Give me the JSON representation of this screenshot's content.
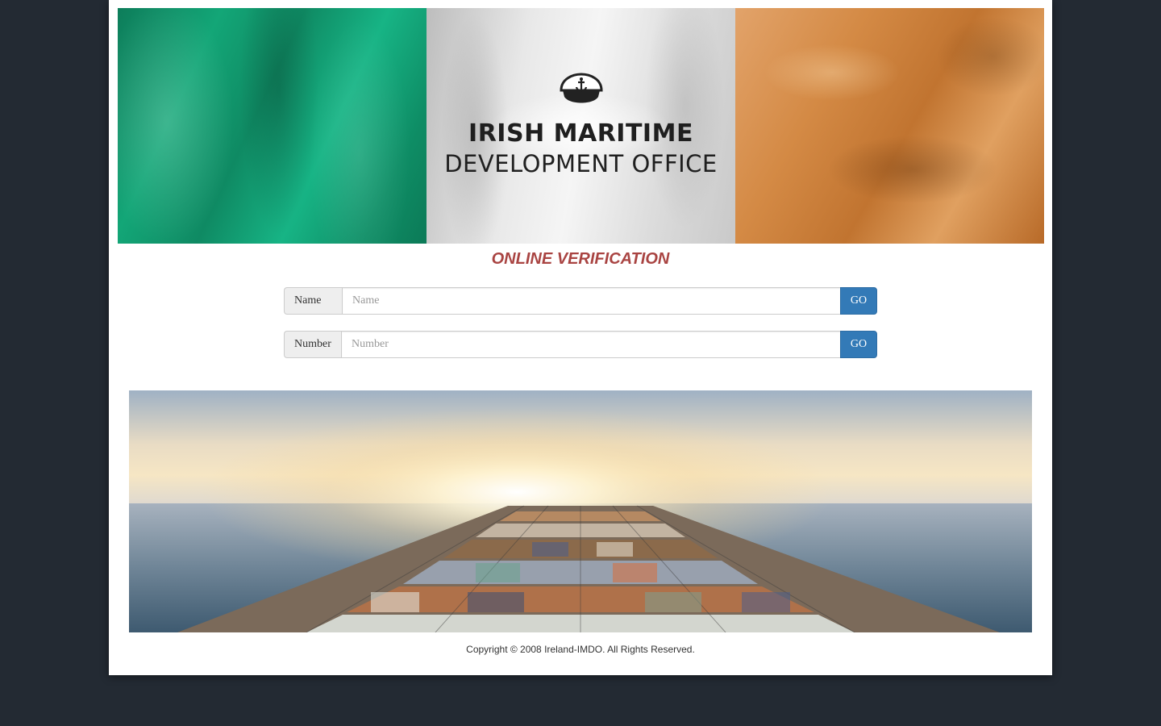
{
  "header": {
    "org_title": "IRISH MARITIME",
    "org_subtitle": "DEVELOPMENT OFFICE",
    "logo_icon": "captain-hat-anchor-icon",
    "flag_colors": [
      "#13a677",
      "#e8e8e8",
      "#d48a45"
    ]
  },
  "main": {
    "heading": "ONLINE VERIFICATION",
    "heading_color": "#a94442",
    "forms": [
      {
        "label": "Name",
        "placeholder": "Name",
        "value": "",
        "button": "GO"
      },
      {
        "label": "Number",
        "placeholder": "Number",
        "value": "",
        "button": "GO"
      }
    ],
    "button_color": "#337ab7",
    "hero_image": "container-ship-at-sunset"
  },
  "footer": {
    "copyright": "Copyright © 2008 Ireland-IMDO. All Rights Reserved."
  }
}
